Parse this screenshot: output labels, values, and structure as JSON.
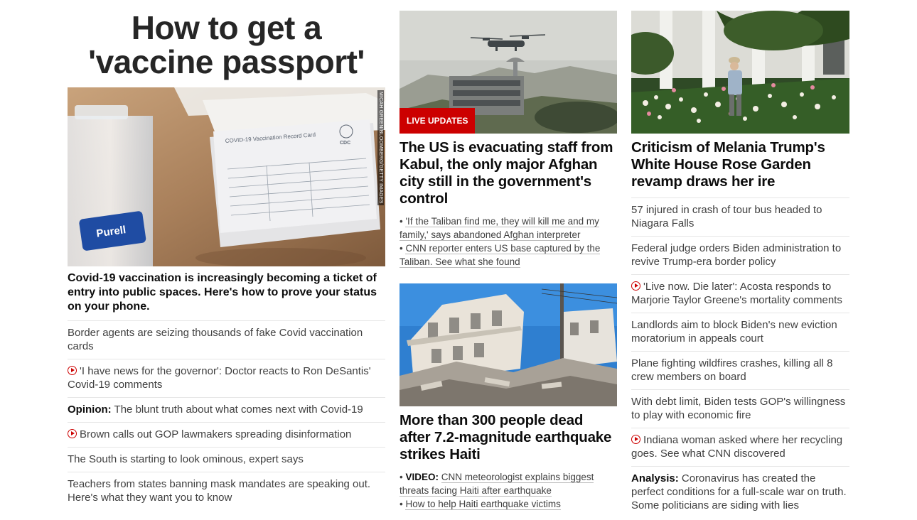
{
  "col1": {
    "hero_title": "How to get a 'vaccine passport'",
    "photo_credit": "MICAH GREEN/BLOOMBERG/GETTY IMAGES",
    "card_text": "COVID-19 Vaccination Record Card",
    "card_cdc": "CDC",
    "bottle_brand": "Purell",
    "lead_text": "Covid-19 vaccination is increasingly becoming a ticket of entry into public spaces. Here's how to prove your status on your phone.",
    "list": [
      {
        "text": "Border agents are seizing thousands of fake Covid vaccination cards"
      },
      {
        "text": "'I have news for the governor': Doctor reacts to Ron DeSantis' Covid-19 comments",
        "video": true
      },
      {
        "label": "Opinion:",
        "text": " The blunt truth about what comes next with Covid-19"
      },
      {
        "text": "Brown calls out GOP lawmakers spreading disinformation",
        "video": true
      },
      {
        "text": "The South is starting to look ominous, expert says"
      },
      {
        "text": "Teachers from states banning mask mandates are speaking out. Here's what they want you to know"
      }
    ]
  },
  "col2": {
    "story1": {
      "badge": "LIVE UPDATES",
      "headline": "The US is evacuating staff from Kabul, the only major Afghan city still in the government's control",
      "related": [
        {
          "text": "'If the Taliban find me, they will kill me and my family,' says abandoned Afghan interpreter"
        },
        {
          "text": "CNN reporter enters US base captured by the Taliban. See what she found"
        }
      ]
    },
    "story2": {
      "headline": "More than 300 people dead after 7.2-magnitude earthquake strikes Haiti",
      "related": [
        {
          "label": "VIDEO:",
          "text": "CNN meteorologist explains biggest threats facing Haiti after earthquake"
        },
        {
          "text": "How to help Haiti earthquake victims"
        }
      ]
    }
  },
  "col3": {
    "headline": "Criticism of Melania Trump's White House Rose Garden revamp draws her ire",
    "list": [
      {
        "text": "57 injured in crash of tour bus headed to Niagara Falls"
      },
      {
        "text": "Federal judge orders Biden administration to revive Trump-era border policy"
      },
      {
        "text": "'Live now. Die later': Acosta responds to Marjorie Taylor Greene's mortality comments",
        "video": true
      },
      {
        "text": "Landlords aim to block Biden's new eviction moratorium in appeals court"
      },
      {
        "text": "Plane fighting wildfires crashes, killing all 8 crew members on board"
      },
      {
        "text": "With debt limit, Biden tests GOP's willingness to play with economic fire"
      },
      {
        "text": "Indiana woman asked where her recycling goes. See what CNN discovered",
        "video": true
      },
      {
        "label": "Analysis:",
        "text": " Coronavirus has created the perfect conditions for a full-scale war on truth. Some politicians are siding with lies"
      }
    ]
  },
  "colors": {
    "accent": "#cc0000",
    "headline": "#0c0c0c",
    "text": "#404040",
    "divider": "#e6e6e6"
  }
}
